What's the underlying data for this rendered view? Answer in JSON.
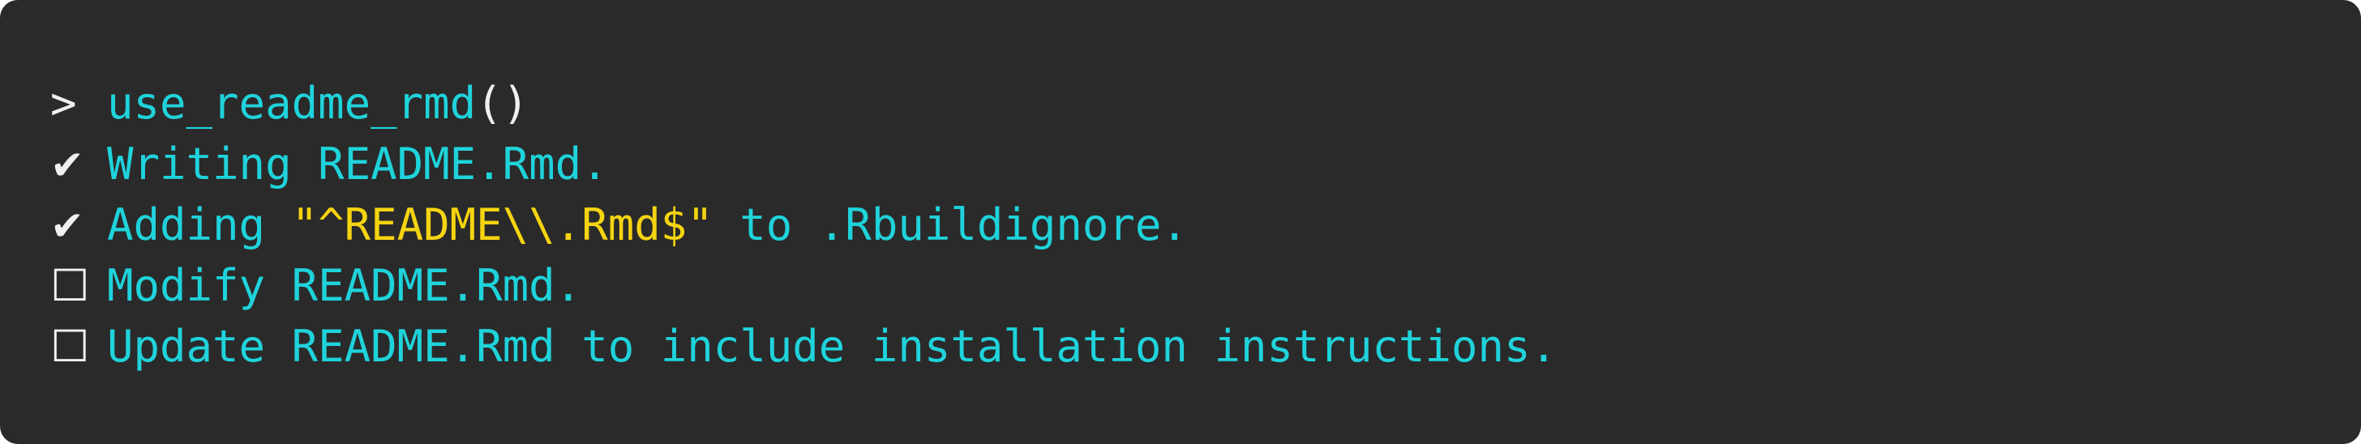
{
  "console": {
    "lines": [
      {
        "prefix": ">",
        "function_name": "use_readme_rmd",
        "parens": "()"
      },
      {
        "prefix": "✔",
        "text": "Writing README.Rmd."
      },
      {
        "prefix": "✔",
        "before": "Adding ",
        "quoted": "\"^README\\\\.Rmd$\"",
        "after": " to .Rbuildignore."
      },
      {
        "prefix": "☐",
        "text": "Modify README.Rmd."
      },
      {
        "prefix": "☐",
        "text": "Update README.Rmd to include installation instructions."
      }
    ]
  },
  "colors": {
    "background": "#2a2a2a",
    "text_cyan": "#1fd3db",
    "text_white": "#f0f0f0",
    "text_yellow": "#f5d410"
  }
}
